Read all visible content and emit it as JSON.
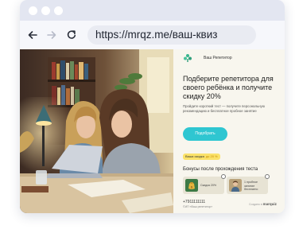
{
  "browser": {
    "url": "https://mrqz.me/ваш-квиз",
    "icons": [
      "back-arrow-icon",
      "forward-arrow-icon",
      "reload-icon"
    ]
  },
  "panel": {
    "brand_name": "Ваш Репетитор",
    "headline": "Подберите репетитора для своего ребёнка и получите скидку 20%",
    "description": "Пройдите короткий тест — получите персональную рекомендацию и бесплатное пробное занятие",
    "cta_label": "Подобрать",
    "discount": {
      "label": "Ваша скидка",
      "value": "до 20 %"
    },
    "bonuses_title": "Бонусы после прохождения теста",
    "bonuses": [
      {
        "icon": "money-bag-icon",
        "text": "Скидка 20%"
      },
      {
        "icon": "teacher-photo-icon",
        "text": "1 пробное занятие бесплатно"
      }
    ],
    "phone": "+7911111111",
    "footer_note": "©ИП «Ваш репетитор»",
    "created_with": "Создано в",
    "marquiz_logo": "marquiz"
  },
  "colors": {
    "accent": "#2fc6d1",
    "badge": "#fbe26a",
    "panel_bg": "#f8f6ee",
    "titlebar": "#e3e6f1"
  }
}
